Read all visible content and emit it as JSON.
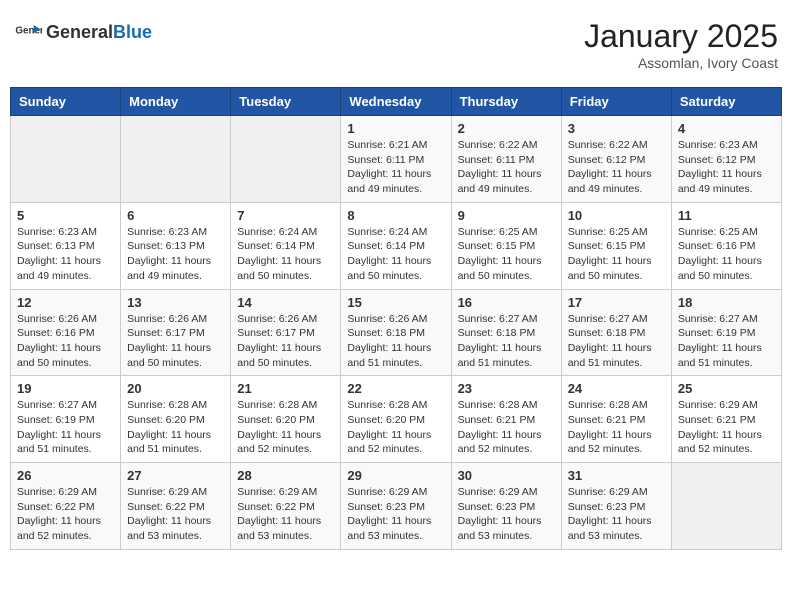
{
  "header": {
    "logo_general": "General",
    "logo_blue": "Blue",
    "month_year": "January 2025",
    "location": "Assomlan, Ivory Coast"
  },
  "weekdays": [
    "Sunday",
    "Monday",
    "Tuesday",
    "Wednesday",
    "Thursday",
    "Friday",
    "Saturday"
  ],
  "weeks": [
    [
      {
        "day": "",
        "info": ""
      },
      {
        "day": "",
        "info": ""
      },
      {
        "day": "",
        "info": ""
      },
      {
        "day": "1",
        "info": "Sunrise: 6:21 AM\nSunset: 6:11 PM\nDaylight: 11 hours and 49 minutes."
      },
      {
        "day": "2",
        "info": "Sunrise: 6:22 AM\nSunset: 6:11 PM\nDaylight: 11 hours and 49 minutes."
      },
      {
        "day": "3",
        "info": "Sunrise: 6:22 AM\nSunset: 6:12 PM\nDaylight: 11 hours and 49 minutes."
      },
      {
        "day": "4",
        "info": "Sunrise: 6:23 AM\nSunset: 6:12 PM\nDaylight: 11 hours and 49 minutes."
      }
    ],
    [
      {
        "day": "5",
        "info": "Sunrise: 6:23 AM\nSunset: 6:13 PM\nDaylight: 11 hours and 49 minutes."
      },
      {
        "day": "6",
        "info": "Sunrise: 6:23 AM\nSunset: 6:13 PM\nDaylight: 11 hours and 49 minutes."
      },
      {
        "day": "7",
        "info": "Sunrise: 6:24 AM\nSunset: 6:14 PM\nDaylight: 11 hours and 50 minutes."
      },
      {
        "day": "8",
        "info": "Sunrise: 6:24 AM\nSunset: 6:14 PM\nDaylight: 11 hours and 50 minutes."
      },
      {
        "day": "9",
        "info": "Sunrise: 6:25 AM\nSunset: 6:15 PM\nDaylight: 11 hours and 50 minutes."
      },
      {
        "day": "10",
        "info": "Sunrise: 6:25 AM\nSunset: 6:15 PM\nDaylight: 11 hours and 50 minutes."
      },
      {
        "day": "11",
        "info": "Sunrise: 6:25 AM\nSunset: 6:16 PM\nDaylight: 11 hours and 50 minutes."
      }
    ],
    [
      {
        "day": "12",
        "info": "Sunrise: 6:26 AM\nSunset: 6:16 PM\nDaylight: 11 hours and 50 minutes."
      },
      {
        "day": "13",
        "info": "Sunrise: 6:26 AM\nSunset: 6:17 PM\nDaylight: 11 hours and 50 minutes."
      },
      {
        "day": "14",
        "info": "Sunrise: 6:26 AM\nSunset: 6:17 PM\nDaylight: 11 hours and 50 minutes."
      },
      {
        "day": "15",
        "info": "Sunrise: 6:26 AM\nSunset: 6:18 PM\nDaylight: 11 hours and 51 minutes."
      },
      {
        "day": "16",
        "info": "Sunrise: 6:27 AM\nSunset: 6:18 PM\nDaylight: 11 hours and 51 minutes."
      },
      {
        "day": "17",
        "info": "Sunrise: 6:27 AM\nSunset: 6:18 PM\nDaylight: 11 hours and 51 minutes."
      },
      {
        "day": "18",
        "info": "Sunrise: 6:27 AM\nSunset: 6:19 PM\nDaylight: 11 hours and 51 minutes."
      }
    ],
    [
      {
        "day": "19",
        "info": "Sunrise: 6:27 AM\nSunset: 6:19 PM\nDaylight: 11 hours and 51 minutes."
      },
      {
        "day": "20",
        "info": "Sunrise: 6:28 AM\nSunset: 6:20 PM\nDaylight: 11 hours and 51 minutes."
      },
      {
        "day": "21",
        "info": "Sunrise: 6:28 AM\nSunset: 6:20 PM\nDaylight: 11 hours and 52 minutes."
      },
      {
        "day": "22",
        "info": "Sunrise: 6:28 AM\nSunset: 6:20 PM\nDaylight: 11 hours and 52 minutes."
      },
      {
        "day": "23",
        "info": "Sunrise: 6:28 AM\nSunset: 6:21 PM\nDaylight: 11 hours and 52 minutes."
      },
      {
        "day": "24",
        "info": "Sunrise: 6:28 AM\nSunset: 6:21 PM\nDaylight: 11 hours and 52 minutes."
      },
      {
        "day": "25",
        "info": "Sunrise: 6:29 AM\nSunset: 6:21 PM\nDaylight: 11 hours and 52 minutes."
      }
    ],
    [
      {
        "day": "26",
        "info": "Sunrise: 6:29 AM\nSunset: 6:22 PM\nDaylight: 11 hours and 52 minutes."
      },
      {
        "day": "27",
        "info": "Sunrise: 6:29 AM\nSunset: 6:22 PM\nDaylight: 11 hours and 53 minutes."
      },
      {
        "day": "28",
        "info": "Sunrise: 6:29 AM\nSunset: 6:22 PM\nDaylight: 11 hours and 53 minutes."
      },
      {
        "day": "29",
        "info": "Sunrise: 6:29 AM\nSunset: 6:23 PM\nDaylight: 11 hours and 53 minutes."
      },
      {
        "day": "30",
        "info": "Sunrise: 6:29 AM\nSunset: 6:23 PM\nDaylight: 11 hours and 53 minutes."
      },
      {
        "day": "31",
        "info": "Sunrise: 6:29 AM\nSunset: 6:23 PM\nDaylight: 11 hours and 53 minutes."
      },
      {
        "day": "",
        "info": ""
      }
    ]
  ]
}
